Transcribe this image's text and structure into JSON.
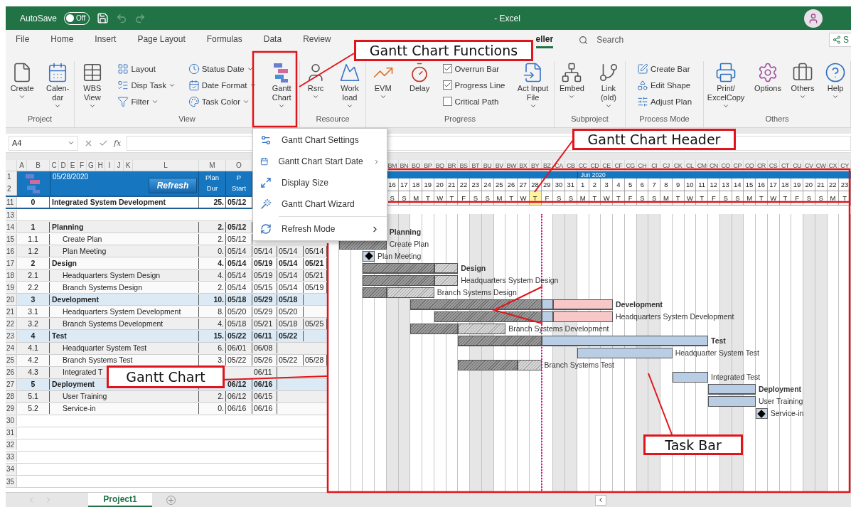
{
  "title_bar": {
    "autosave_label": "AutoSave",
    "autosave": {
      "label": "Off",
      "on": false
    },
    "title": "- Excel"
  },
  "menu_tabs": [
    {
      "label": "File",
      "selected": false
    },
    {
      "label": "Home",
      "selected": false
    },
    {
      "label": "Insert",
      "selected": false
    },
    {
      "label": "Page Layout",
      "selected": false
    },
    {
      "label": "Formulas",
      "selected": false
    },
    {
      "label": "Data",
      "selected": false
    },
    {
      "label": "Review",
      "selected": false
    },
    {
      "label": "eller",
      "selected": true
    }
  ],
  "search": {
    "placeholder": "Search"
  },
  "share": {
    "label": "S"
  },
  "ribbon": {
    "groups": [
      {
        "label": "Project",
        "items": [
          {
            "kind": "large",
            "lines": [
              "Create"
            ],
            "dropdown": true
          },
          {
            "kind": "large",
            "lines": [
              "Calen-",
              "dar"
            ],
            "dropdown": true
          }
        ]
      },
      {
        "label": "View",
        "items": [
          {
            "kind": "large",
            "lines": [
              "WBS",
              "View"
            ],
            "dropdown": true
          },
          {
            "kind": "stack",
            "items": [
              {
                "kind": "small",
                "label": "Layout",
                "dropdown": false
              },
              {
                "kind": "small",
                "label": "Disp Task",
                "dropdown": true
              },
              {
                "kind": "small",
                "label": "Filter",
                "dropdown": true
              }
            ]
          },
          {
            "kind": "stack",
            "items": [
              {
                "kind": "small",
                "label": "Status Date",
                "dropdown": true
              },
              {
                "kind": "small",
                "label": "Date Format",
                "dropdown": true
              },
              {
                "kind": "small",
                "label": "Task Color",
                "dropdown": true
              }
            ]
          },
          {
            "kind": "large",
            "lines": [
              "Gantt",
              "Chart"
            ],
            "dropdown": true
          }
        ]
      },
      {
        "label": "Resource",
        "items": [
          {
            "kind": "large",
            "lines": [
              "Rsrc"
            ],
            "dropdown": true
          },
          {
            "kind": "large",
            "lines": [
              "Work",
              "load"
            ],
            "dropdown": true
          }
        ]
      },
      {
        "label": "Progress",
        "items": [
          {
            "kind": "large",
            "lines": [
              "EVM"
            ],
            "dropdown": true
          },
          {
            "kind": "large",
            "lines": [
              "Delay"
            ],
            "dropdown": false
          },
          {
            "kind": "stack",
            "items": [
              {
                "kind": "check",
                "label": "Overrun Bar",
                "checked": true
              },
              {
                "kind": "check",
                "label": "Progress Line",
                "checked": true
              },
              {
                "kind": "check",
                "label": "Critical Path",
                "checked": false
              }
            ]
          },
          {
            "kind": "large",
            "lines": [
              "Act Input",
              "File"
            ],
            "dropdown": true
          }
        ]
      },
      {
        "label": "Subproject",
        "items": [
          {
            "kind": "large",
            "lines": [
              "Embed"
            ],
            "dropdown": true
          },
          {
            "kind": "large",
            "lines": [
              "Link",
              "(old)"
            ],
            "dropdown": true
          }
        ]
      },
      {
        "label": "Process Mode",
        "items": [
          {
            "kind": "stack",
            "items": [
              {
                "kind": "small",
                "label": "Create Bar",
                "dropdown": false
              },
              {
                "kind": "small",
                "label": "Edit Shape",
                "dropdown": false
              },
              {
                "kind": "small",
                "label": "Adjust Plan",
                "dropdown": false
              }
            ]
          }
        ]
      },
      {
        "label": "Others",
        "items": [
          {
            "kind": "large",
            "lines": [
              "Print/",
              "ExcelCopy"
            ],
            "dropdown": true
          },
          {
            "kind": "large",
            "lines": [
              "Options"
            ],
            "dropdown": false
          },
          {
            "kind": "large",
            "lines": [
              "Others"
            ],
            "dropdown": true
          },
          {
            "kind": "large",
            "lines": [
              "Help"
            ],
            "dropdown": true
          }
        ]
      }
    ]
  },
  "formula_bar": {
    "name_box": "A4",
    "function_label": "fx"
  },
  "sheet": {
    "column_letters": [
      "A",
      "B",
      "C",
      "D",
      "E",
      "F",
      "G",
      "H",
      "I",
      "J",
      "K",
      "L",
      "M",
      "O"
    ],
    "header": {
      "row_numbers": [
        "1",
        "2"
      ],
      "date": "05/28/2020",
      "refresh": "Refresh",
      "columns": [
        {
          "lines": [
            "Plan",
            "Dur"
          ]
        },
        {
          "lines": [
            "P",
            "Start"
          ]
        }
      ]
    },
    "rows": [
      {
        "row": "11",
        "wbs": "0",
        "task": "Integrated System Development",
        "dur": "25.",
        "plan_start": "05/12",
        "kind": "project",
        "highlighted": false
      },
      {
        "row": "13",
        "kind": "blank"
      },
      {
        "row": "14",
        "wbs": "1",
        "task": "Planning",
        "dur": "2.",
        "plan_start": "05/12",
        "kind": "summary",
        "highlighted": false,
        "bar_label": "Planning"
      },
      {
        "row": "15",
        "wbs": "1.1",
        "task": "Create Plan",
        "dur": "2.",
        "plan_start": "05/12",
        "kind": "task",
        "highlighted": false,
        "bar_label": "Create Plan"
      },
      {
        "row": "16",
        "wbs": "1.2",
        "task": "Plan Meeting",
        "dur": "0.",
        "plan_start": "05/14",
        "plan_end": "05/14",
        "actual_start": "05/14",
        "actual_end": "05/14",
        "kind": "task",
        "highlighted": false,
        "bar_label": "Plan Meeting"
      },
      {
        "row": "17",
        "wbs": "2",
        "task": "Design",
        "dur": "4.",
        "plan_start": "05/14",
        "plan_end": "05/19",
        "actual_start": "05/14",
        "actual_end": "05/21",
        "kind": "summary",
        "highlighted": false,
        "bar_label": "Design"
      },
      {
        "row": "18",
        "wbs": "2.1",
        "task": "Headquarters System Design",
        "dur": "4.",
        "plan_start": "05/14",
        "plan_end": "05/19",
        "actual_start": "05/14",
        "actual_end": "05/21",
        "kind": "task",
        "highlighted": false,
        "bar_label": "Headquarters System Design"
      },
      {
        "row": "19",
        "wbs": "2.2",
        "task": "Branch Systems Design",
        "dur": "2.",
        "plan_start": "05/14",
        "plan_end": "05/15",
        "actual_start": "05/14",
        "actual_end": "05/19",
        "kind": "task",
        "highlighted": false,
        "bar_label": "Branch Systems Design"
      },
      {
        "row": "20",
        "wbs": "3",
        "task": "Development",
        "dur": "10.",
        "plan_start": "05/18",
        "plan_end": "05/29",
        "actual_start": "05/18",
        "kind": "summary",
        "highlighted": true,
        "bar_label": "Development"
      },
      {
        "row": "21",
        "wbs": "3.1",
        "task": "Headquarters System Development",
        "dur": "8.",
        "plan_start": "05/20",
        "plan_end": "05/29",
        "actual_start": "05/20",
        "kind": "task",
        "highlighted": false,
        "bar_label": "Headquarters System Development"
      },
      {
        "row": "22",
        "wbs": "3.2",
        "task": "Branch Systems Development",
        "dur": "4.",
        "plan_start": "05/18",
        "plan_end": "05/21",
        "actual_start": "05/18",
        "actual_end": "05/25",
        "kind": "task",
        "highlighted": false,
        "bar_label": "Branch Systems Development"
      },
      {
        "row": "23",
        "wbs": "4",
        "task": "Test",
        "dur": "15.",
        "plan_start": "05/22",
        "plan_end": "06/11",
        "actual_start": "05/22",
        "kind": "summary",
        "highlighted": true,
        "bar_label": "Test"
      },
      {
        "row": "24",
        "wbs": "4.1",
        "task": "Headquarter System Test",
        "dur": "6.",
        "plan_start": "06/01",
        "plan_end": "06/08",
        "kind": "task",
        "highlighted": false,
        "bar_label": "Headquarter System Test"
      },
      {
        "row": "25",
        "wbs": "4.2",
        "task": "Branch Systems Test",
        "dur": "3.",
        "plan_start": "05/22",
        "plan_end": "05/26",
        "actual_start": "05/22",
        "actual_end": "05/28",
        "kind": "task",
        "highlighted": false,
        "bar_label": "Branch Systems Test"
      },
      {
        "row": "26",
        "wbs": "4.3",
        "task": "Integrated T",
        "plan_end": "06/11",
        "kind": "task",
        "highlighted": false,
        "bar_label": "Integrated Test"
      },
      {
        "row": "27",
        "wbs": "5",
        "task": "Deployment",
        "plan_start": "06/12",
        "plan_end": "06/16",
        "kind": "summary",
        "highlighted": true,
        "bar_label": "Deployment"
      },
      {
        "row": "28",
        "wbs": "5.1",
        "task": "User Training",
        "dur": "2.",
        "plan_start": "06/12",
        "plan_end": "06/15",
        "kind": "task",
        "highlighted": false,
        "bar_label": "User Training"
      },
      {
        "row": "29",
        "wbs": "5.2",
        "task": "Service-in",
        "dur": "0.",
        "plan_start": "06/16",
        "plan_end": "06/16",
        "kind": "task",
        "highlighted": false,
        "bar_label": "Service-in"
      },
      {
        "row": "30",
        "kind": "blank"
      },
      {
        "row": "31",
        "kind": "blank"
      },
      {
        "row": "32",
        "kind": "blank"
      },
      {
        "row": "33",
        "kind": "blank"
      },
      {
        "row": "34",
        "kind": "blank"
      },
      {
        "row": "35",
        "kind": "blank"
      }
    ]
  },
  "gantt": {
    "days": [
      {
        "col": "BM",
        "day": "16",
        "weekday": "S",
        "weekend": true,
        "today": false
      },
      {
        "col": "BN",
        "day": "17",
        "weekday": "S",
        "weekend": true,
        "today": false
      },
      {
        "col": "BO",
        "day": "18",
        "weekday": "M",
        "weekend": false,
        "today": false
      },
      {
        "col": "BP",
        "day": "19",
        "weekday": "T",
        "weekend": false,
        "today": false
      },
      {
        "col": "BQ",
        "day": "20",
        "weekday": "W",
        "weekend": false,
        "today": false
      },
      {
        "col": "BR",
        "day": "21",
        "weekday": "T",
        "weekend": false,
        "today": false
      },
      {
        "col": "BS",
        "day": "22",
        "weekday": "F",
        "weekend": false,
        "today": false
      },
      {
        "col": "BT",
        "day": "23",
        "weekday": "S",
        "weekend": true,
        "today": false
      },
      {
        "col": "BU",
        "day": "24",
        "weekday": "S",
        "weekend": true,
        "today": false
      },
      {
        "col": "BV",
        "day": "25",
        "weekday": "M",
        "weekend": false,
        "today": false
      },
      {
        "col": "BW",
        "day": "26",
        "weekday": "T",
        "weekend": false,
        "today": false
      },
      {
        "col": "BX",
        "day": "27",
        "weekday": "W",
        "weekend": false,
        "today": false
      },
      {
        "col": "BY",
        "day": "28",
        "weekday": "T",
        "weekend": false,
        "today": true
      },
      {
        "col": "BZ",
        "day": "29",
        "weekday": "F",
        "weekend": false,
        "today": false
      },
      {
        "col": "CA",
        "day": "30",
        "weekday": "S",
        "weekend": true,
        "today": false
      },
      {
        "col": "CB",
        "day": "31",
        "weekday": "S",
        "weekend": true,
        "today": false
      },
      {
        "col": "CC",
        "day": "1",
        "weekday": "M",
        "weekend": false,
        "today": false,
        "month": "Jun 2020"
      },
      {
        "col": "CD",
        "day": "2",
        "weekday": "T",
        "weekend": false,
        "today": false
      },
      {
        "col": "CE",
        "day": "3",
        "weekday": "W",
        "weekend": false,
        "today": false
      },
      {
        "col": "CF",
        "day": "4",
        "weekday": "T",
        "weekend": false,
        "today": false
      },
      {
        "col": "CG",
        "day": "5",
        "weekday": "F",
        "weekend": false,
        "today": false
      },
      {
        "col": "CH",
        "day": "6",
        "weekday": "S",
        "weekend": true,
        "today": false
      },
      {
        "col": "CI",
        "day": "7",
        "weekday": "S",
        "weekend": true,
        "today": false
      },
      {
        "col": "CJ",
        "day": "8",
        "weekday": "M",
        "weekend": false,
        "today": false
      },
      {
        "col": "CK",
        "day": "9",
        "weekday": "T",
        "weekend": false,
        "today": false
      },
      {
        "col": "CL",
        "day": "10",
        "weekday": "W",
        "weekend": false,
        "today": false
      },
      {
        "col": "CM",
        "day": "11",
        "weekday": "T",
        "weekend": false,
        "today": false
      },
      {
        "col": "CN",
        "day": "12",
        "weekday": "F",
        "weekend": false,
        "today": false
      },
      {
        "col": "CO",
        "day": "13",
        "weekday": "S",
        "weekend": true,
        "today": false
      },
      {
        "col": "CP",
        "day": "14",
        "weekday": "S",
        "weekend": true,
        "today": false
      },
      {
        "col": "CQ",
        "day": "15",
        "weekday": "M",
        "weekend": false,
        "today": false
      },
      {
        "col": "CR",
        "day": "16",
        "weekday": "T",
        "weekend": false,
        "today": false
      },
      {
        "col": "CS",
        "day": "17",
        "weekday": "W",
        "weekend": false,
        "today": false
      },
      {
        "col": "CT",
        "day": "18",
        "weekday": "T",
        "weekend": false,
        "today": false
      },
      {
        "col": "CU",
        "day": "19",
        "weekday": "F",
        "weekend": false,
        "today": false
      },
      {
        "col": "CV",
        "day": "20",
        "weekday": "S",
        "weekend": true,
        "today": false
      },
      {
        "col": "CW",
        "day": "21",
        "weekday": "S",
        "weekend": true,
        "today": false
      },
      {
        "col": "CX",
        "day": "22",
        "weekday": "M",
        "weekend": false,
        "today": false
      },
      {
        "col": "CY",
        "day": "23",
        "weekday": "T",
        "weekend": false,
        "today": false
      }
    ]
  },
  "context_menu": [
    {
      "label": "Gantt Chart Settings",
      "submenu": false
    },
    {
      "label": "Gantt Chart Start Date",
      "submenu": true
    },
    {
      "label": "Display Size",
      "submenu": false
    },
    {
      "label": "Gantt Chart Wizard",
      "submenu": false
    },
    {
      "label": "Refresh Mode",
      "submenu": true
    }
  ],
  "callouts": [
    {
      "text": "Gantt Chart Functions"
    },
    {
      "text": "Gantt Chart Header"
    },
    {
      "text": "Gantt Chart"
    },
    {
      "text": "Task Bar"
    }
  ],
  "sheet_tabs": [
    {
      "label": "Project1",
      "selected": true
    }
  ]
}
